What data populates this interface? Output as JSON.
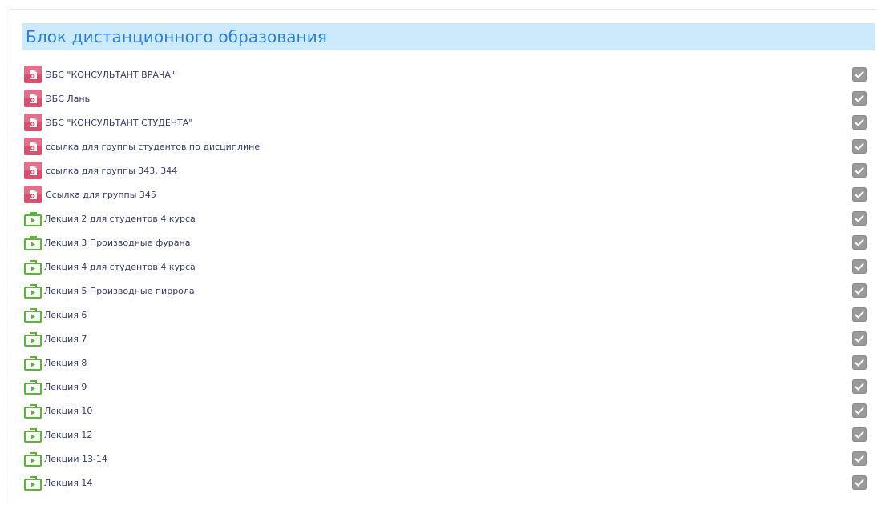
{
  "section": {
    "title": "Блок дистанционного образования"
  },
  "colors": {
    "header_bg": "#cdeafd",
    "title": "#2b7fd9",
    "url_icon": "#d9506f",
    "lecture_icon": "#57b833",
    "checkbox": "#9a9a9a"
  },
  "activities": [
    {
      "type": "url",
      "icon": "url-icon",
      "label": "ЭБС \"КОНСУЛЬТАНТ ВРАЧА\"",
      "completed": true
    },
    {
      "type": "url",
      "icon": "url-icon",
      "label": "ЭБС Лань",
      "completed": true
    },
    {
      "type": "url",
      "icon": "url-icon",
      "label": "ЭБС \"КОНСУЛЬТАНТ СТУДЕНТА\"",
      "completed": true
    },
    {
      "type": "url",
      "icon": "url-icon",
      "label": "ссылка для группы студентов по дисциплине",
      "completed": true
    },
    {
      "type": "url",
      "icon": "url-icon",
      "label": "ссылка для группы 343, 344",
      "completed": true
    },
    {
      "type": "url",
      "icon": "url-icon",
      "label": "Ссылка для группы 345",
      "completed": true
    },
    {
      "type": "lecture",
      "icon": "lecture-icon",
      "label": "Лекция 2 для студентов 4 курса",
      "completed": true
    },
    {
      "type": "lecture",
      "icon": "lecture-icon",
      "label": "Лекция 3 Производные фурана",
      "completed": true
    },
    {
      "type": "lecture",
      "icon": "lecture-icon",
      "label": "Лекция 4 для студентов 4 курса",
      "completed": true
    },
    {
      "type": "lecture",
      "icon": "lecture-icon",
      "label": "Лекция 5 Производные пиррола",
      "completed": true
    },
    {
      "type": "lecture",
      "icon": "lecture-icon",
      "label": "Лекция 6",
      "completed": true
    },
    {
      "type": "lecture",
      "icon": "lecture-icon",
      "label": "Лекция 7",
      "completed": true
    },
    {
      "type": "lecture",
      "icon": "lecture-icon",
      "label": "Лекция 8",
      "completed": true
    },
    {
      "type": "lecture",
      "icon": "lecture-icon",
      "label": "Лекция 9",
      "completed": true
    },
    {
      "type": "lecture",
      "icon": "lecture-icon",
      "label": "Лекция 10",
      "completed": true
    },
    {
      "type": "lecture",
      "icon": "lecture-icon",
      "label": "Лекция 12",
      "completed": true
    },
    {
      "type": "lecture",
      "icon": "lecture-icon",
      "label": "Лекции 13-14",
      "completed": true
    },
    {
      "type": "lecture",
      "icon": "lecture-icon",
      "label": "Лекция 14",
      "completed": true
    }
  ]
}
